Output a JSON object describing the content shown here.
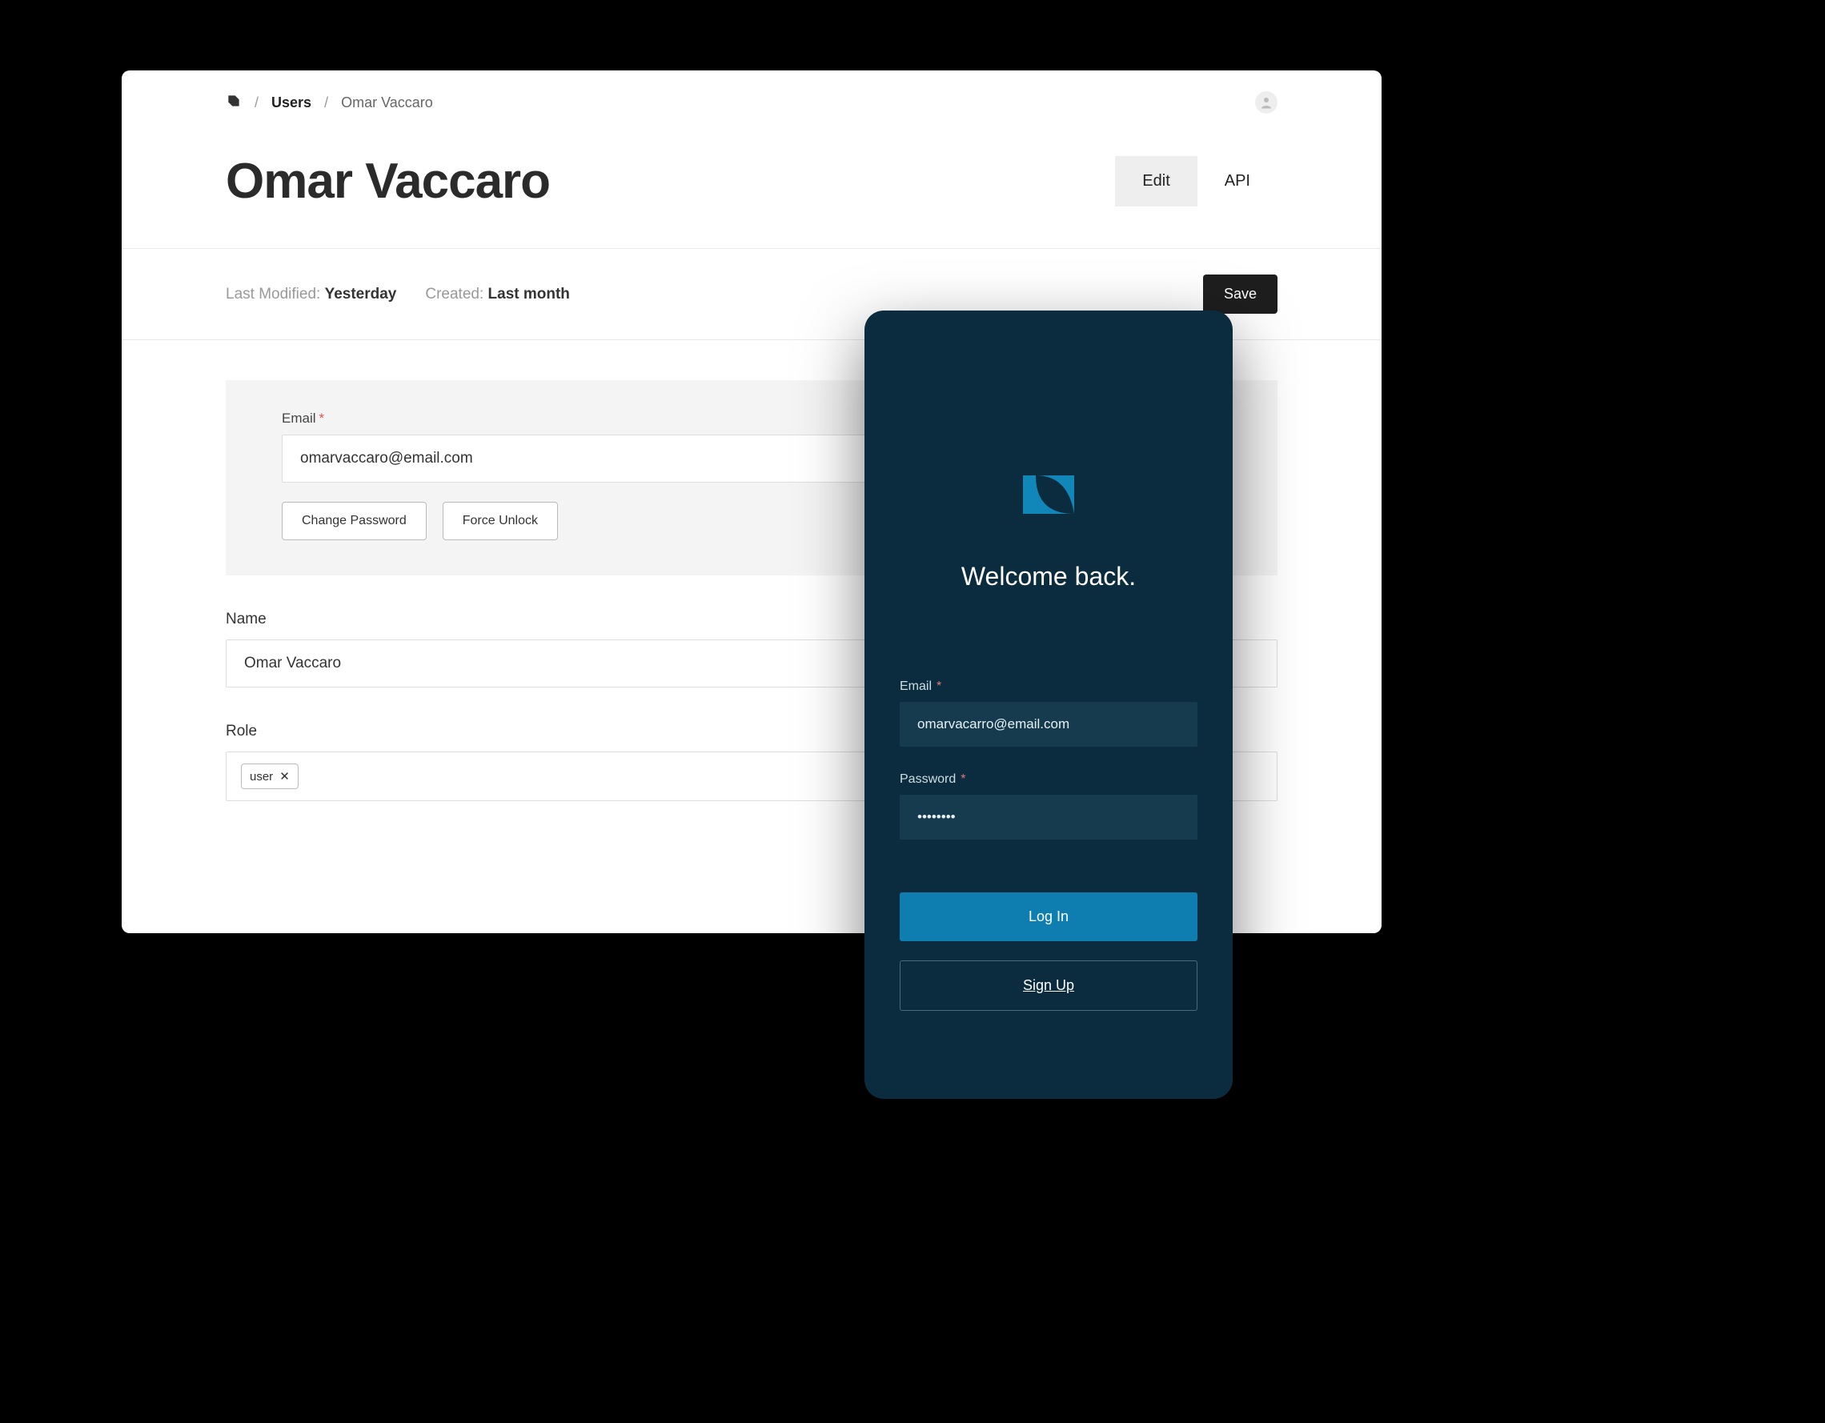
{
  "breadcrumb": {
    "users_label": "Users",
    "name_label": "Omar Vaccaro",
    "separator": "/"
  },
  "page_title": "Omar Vaccaro",
  "tabs": {
    "edit": "Edit",
    "api": "API"
  },
  "meta": {
    "last_modified_label": "Last Modified:",
    "last_modified_value": "Yesterday",
    "created_label": "Created:",
    "created_value": "Last month"
  },
  "save_label": "Save",
  "email_panel": {
    "label": "Email",
    "value": "omarvaccaro@email.com",
    "change_password": "Change Password",
    "force_unlock": "Force Unlock"
  },
  "name_field": {
    "label": "Name",
    "value": "Omar Vaccaro"
  },
  "role_field": {
    "label": "Role",
    "chip": "user",
    "chip_close": "✕"
  },
  "mobile": {
    "welcome": "Welcome back.",
    "email_label": "Email",
    "email_value": "omarvacarro@email.com",
    "password_label": "Password",
    "password_value": "••••••••",
    "login": "Log In",
    "signup": "Sign Up"
  }
}
